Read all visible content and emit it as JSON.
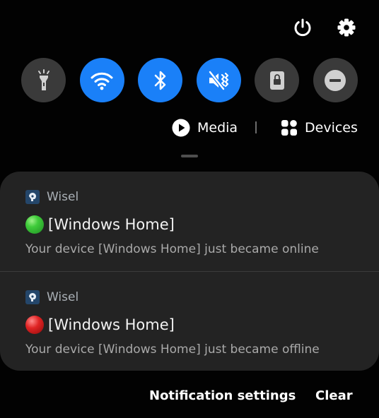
{
  "top_icons": [
    {
      "name": "power-icon"
    },
    {
      "name": "gear-icon"
    }
  ],
  "quick_settings": [
    {
      "name": "flashlight-icon",
      "state": "off"
    },
    {
      "name": "wifi-icon",
      "state": "on"
    },
    {
      "name": "bluetooth-icon",
      "state": "on"
    },
    {
      "name": "vibrate-icon",
      "state": "on"
    },
    {
      "name": "lock-icon",
      "state": "off"
    },
    {
      "name": "do-not-disturb-icon",
      "state": "off"
    }
  ],
  "media_row": {
    "media_label": "Media",
    "devices_label": "Devices"
  },
  "notifications": [
    {
      "app": "Wisel",
      "status_icon": "green-circle-icon",
      "status_color": "#22b33a",
      "title": "[Windows Home]",
      "body": "Your device [Windows Home] just became online"
    },
    {
      "app": "Wisel",
      "status_icon": "red-circle-icon",
      "status_color": "#d61a1a",
      "title": "[Windows Home]",
      "body": "Your device [Windows Home] just became offline"
    }
  ],
  "footer": {
    "settings_label": "Notification settings",
    "clear_label": "Clear"
  },
  "colors": {
    "background": "#020202",
    "tile_on": "#1a80f8",
    "tile_off": "#3a3a3a",
    "card": "#232323"
  }
}
